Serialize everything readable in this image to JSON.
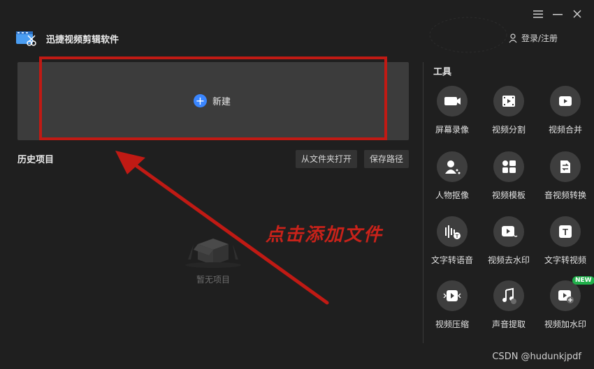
{
  "app": {
    "title": "迅捷视频剪辑软件"
  },
  "window": {
    "menu_icon": "hamburger-icon",
    "minimize_icon": "minimize-icon",
    "close_icon": "close-icon"
  },
  "header": {
    "login_label": "登录/注册"
  },
  "new_project": {
    "label": "新建"
  },
  "history": {
    "title": "历史项目",
    "open_folder_label": "从文件夹打开",
    "save_path_label": "保存路径",
    "empty_text": "暂无项目"
  },
  "annotation": {
    "text": "点击添加文件",
    "color": "#c8221a"
  },
  "tools": {
    "title": "工具",
    "items": [
      {
        "label": "屏幕录像",
        "icon": "screen-record-icon"
      },
      {
        "label": "视频分割",
        "icon": "video-split-icon"
      },
      {
        "label": "视频合并",
        "icon": "video-merge-icon"
      },
      {
        "label": "人物抠像",
        "icon": "person-cutout-icon"
      },
      {
        "label": "视频模板",
        "icon": "video-template-icon"
      },
      {
        "label": "音视频转换",
        "icon": "av-convert-icon"
      },
      {
        "label": "文字转语音",
        "icon": "text-to-speech-icon"
      },
      {
        "label": "视频去水印",
        "icon": "remove-watermark-icon"
      },
      {
        "label": "文字转视频",
        "icon": "text-to-video-icon"
      },
      {
        "label": "视频压缩",
        "icon": "video-compress-icon"
      },
      {
        "label": "声音提取",
        "icon": "audio-extract-icon"
      },
      {
        "label": "视频加水印",
        "icon": "add-watermark-icon",
        "badge": "NEW"
      }
    ]
  },
  "watermark": {
    "text": "CSDN @hudunkjpdf"
  },
  "colors": {
    "accent": "#3a86ff",
    "background": "#1f1f1f",
    "panel": "#3c3c3c",
    "badge": "#21b04b"
  }
}
